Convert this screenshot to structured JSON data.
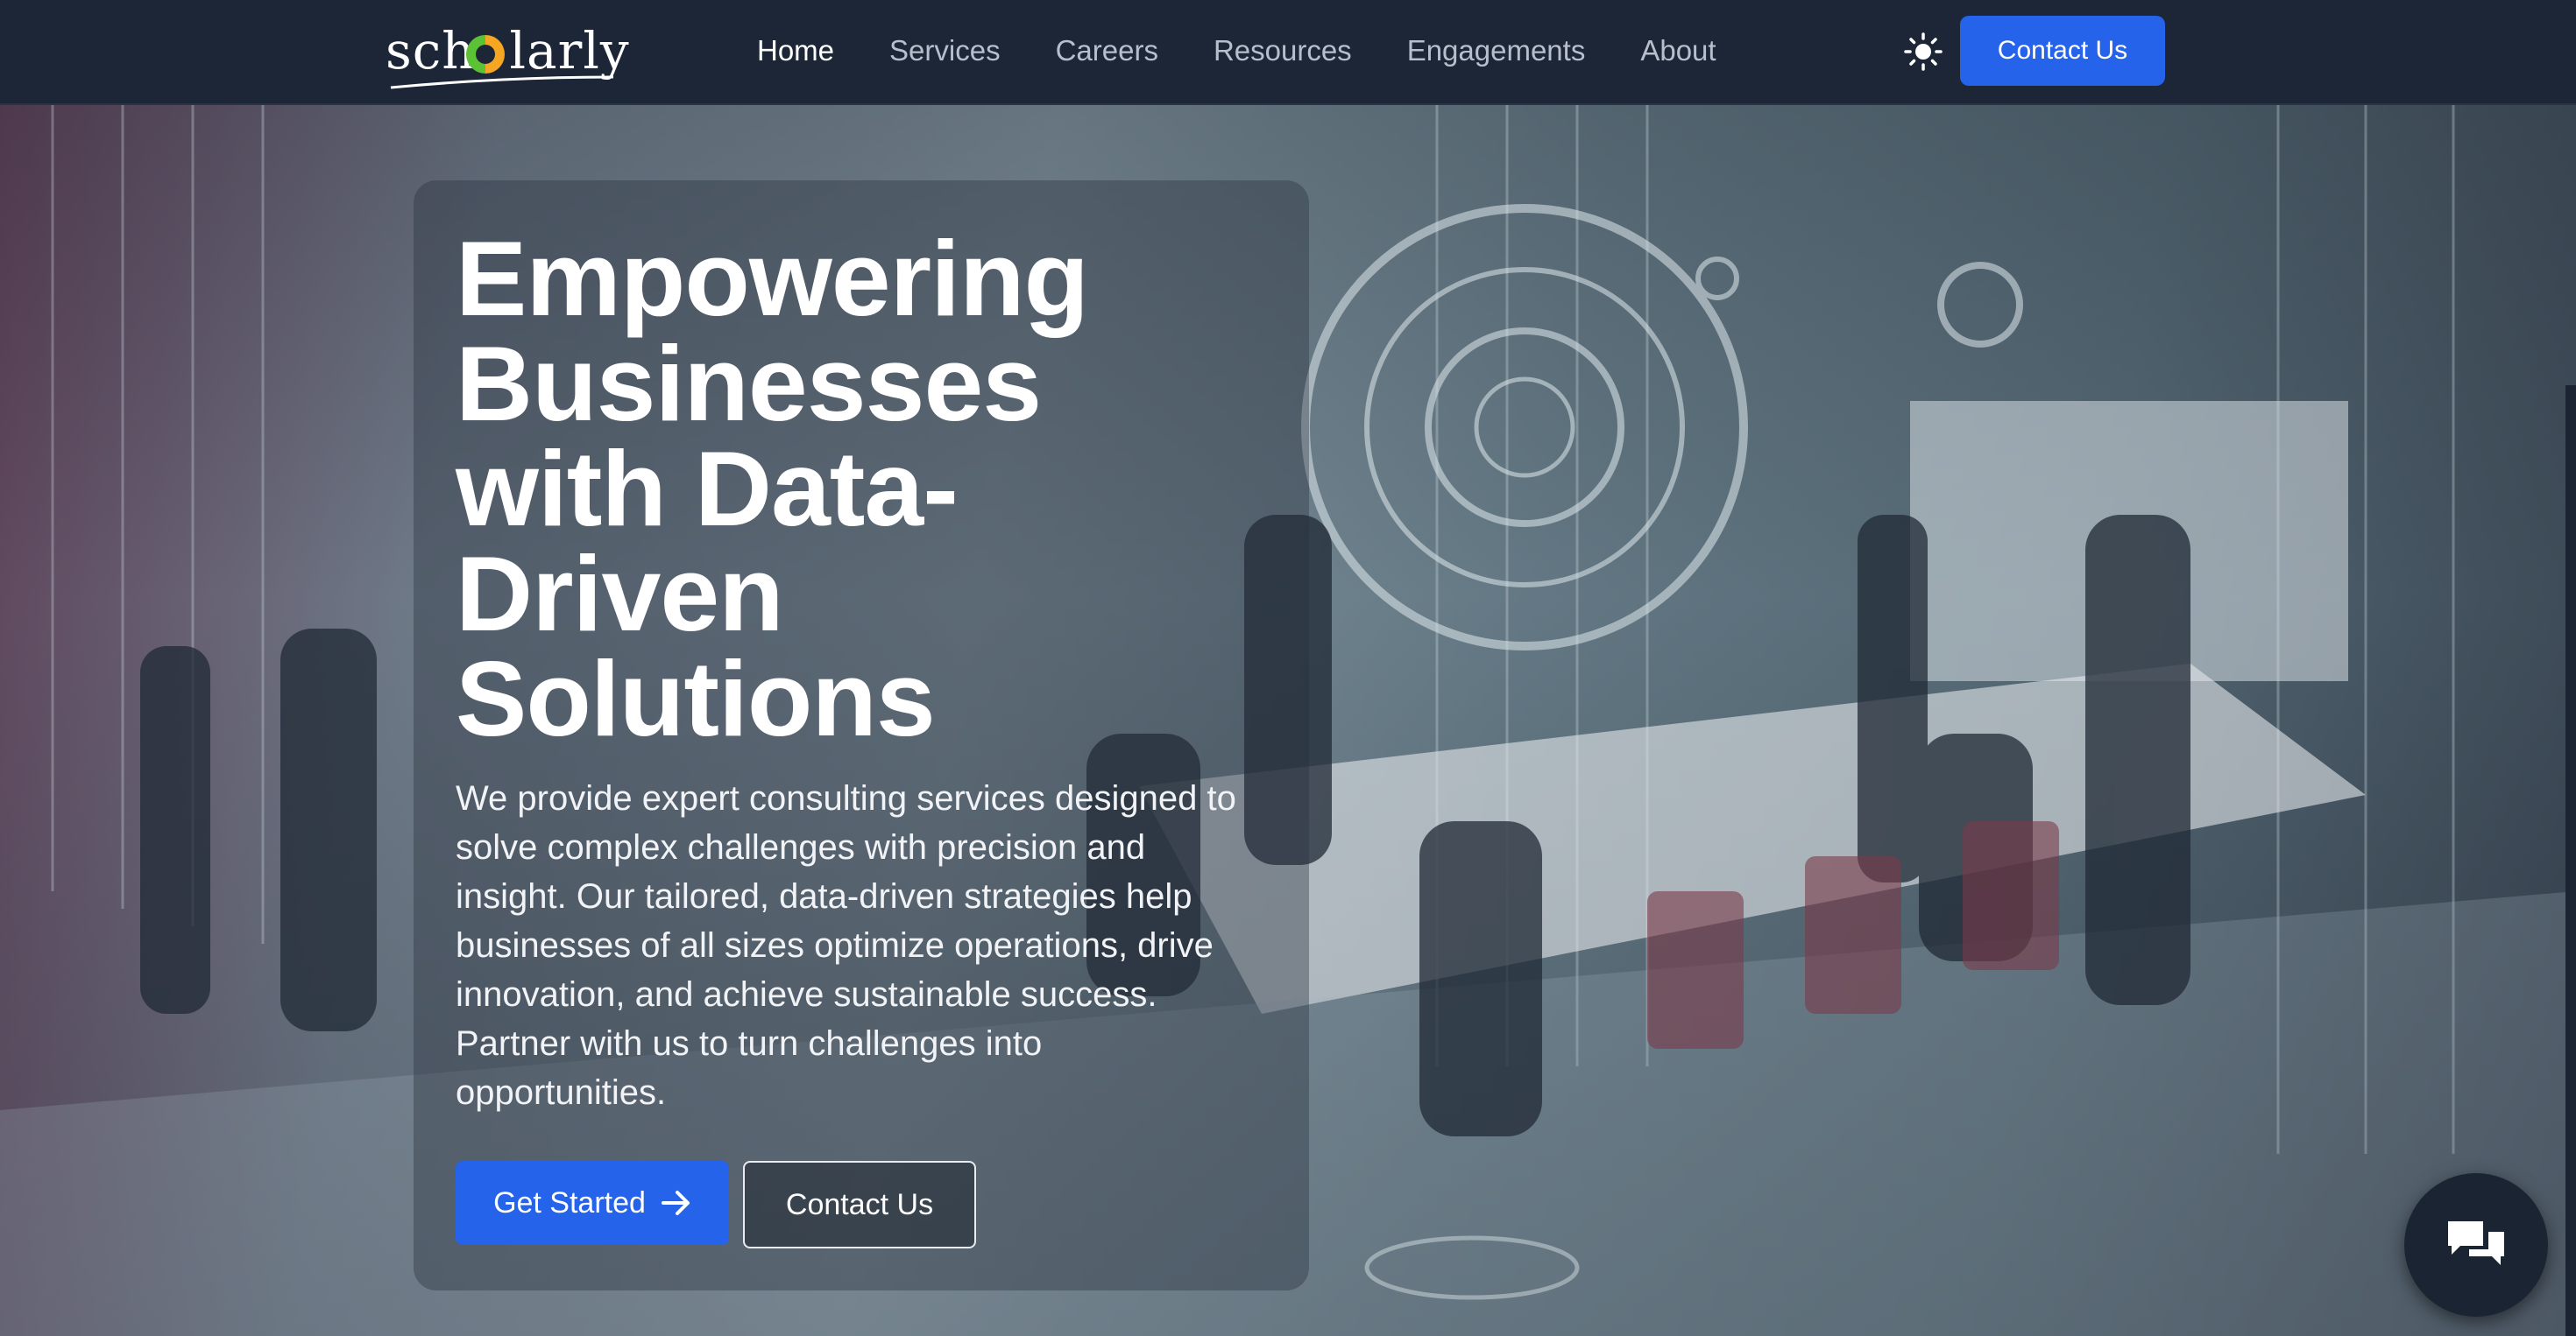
{
  "nav": {
    "logo_text": "sch  larly",
    "links": [
      "Home",
      "Services",
      "Careers",
      "Resources",
      "Engagements",
      "About"
    ],
    "active": "Home",
    "contact_label": "Contact Us",
    "theme_icon": "sun-icon"
  },
  "hero": {
    "title": "Empowering Businesses with Data-Driven Solutions",
    "description": "We provide expert consulting services designed to solve complex challenges with precision and insight. Our tailored, data-driven strategies help businesses of all sizes optimize operations, drive innovation, and achieve sustainable success. Partner with us to turn challenges into opportunities.",
    "primary_button": "Get Started",
    "secondary_button": "Contact Us"
  },
  "chat": {
    "icon": "chat-bubbles-icon"
  },
  "colors": {
    "accent": "#2563eb",
    "nav_bg": "#1c2636"
  }
}
